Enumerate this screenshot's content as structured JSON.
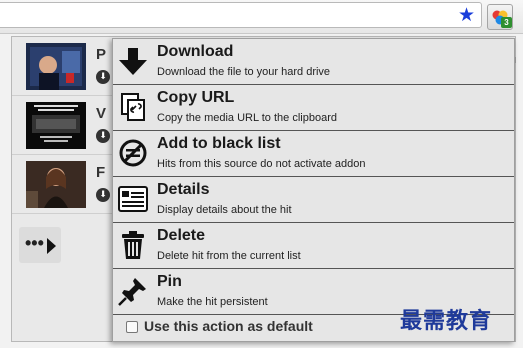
{
  "toolbar": {
    "bookmark_icon": "star-icon",
    "extension_icon": "downloadhelper-icon",
    "extension_badge": "3"
  },
  "hits": [
    {
      "title": "P",
      "download_icon": "download-icon"
    },
    {
      "title": "V",
      "download_icon": "download-icon"
    },
    {
      "title": "F",
      "download_icon": "download-icon"
    }
  ],
  "more": {
    "dots": "•••"
  },
  "menu": {
    "items": [
      {
        "label": "Download",
        "description": "Download the file to your hard drive",
        "icon": "down-arrow-icon"
      },
      {
        "label": "Copy URL",
        "description": "Copy the media URL to the clipboard",
        "icon": "copy-link-icon"
      },
      {
        "label": "Add to black list",
        "description": "Hits from this source do not activate addon",
        "icon": "blocked-icon"
      },
      {
        "label": "Details",
        "description": "Display details about the hit",
        "icon": "details-list-icon"
      },
      {
        "label": "Delete",
        "description": "Delete hit from the current list",
        "icon": "trash-icon"
      },
      {
        "label": "Pin",
        "description": "Make the hit persistent",
        "icon": "pin-icon"
      }
    ],
    "default_action_label": "Use this action as default"
  },
  "watermark": "最需教育",
  "colors": {
    "accent": "#1a3edb",
    "badge": "#2f8f2f",
    "watermark": "#1f3a9a"
  }
}
